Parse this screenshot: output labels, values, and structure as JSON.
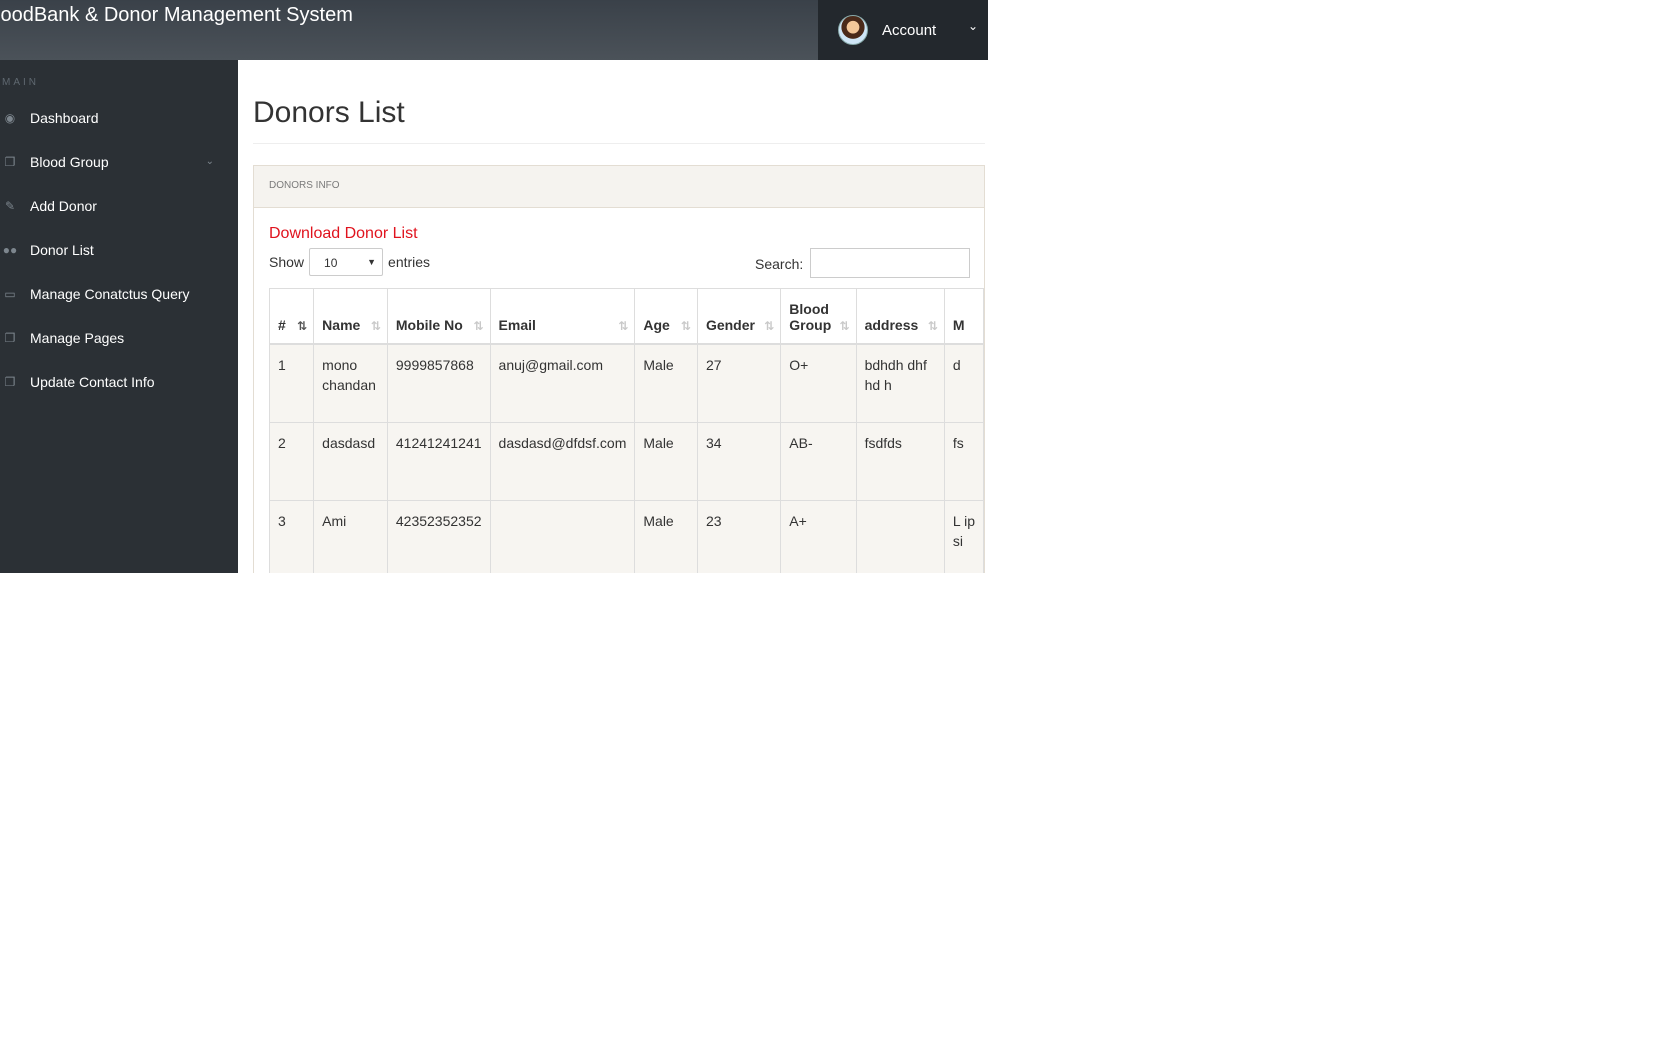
{
  "header": {
    "brand": "loodBank & Donor Management System",
    "account_label": "Account"
  },
  "sidebar": {
    "section": "MAIN",
    "items": [
      {
        "label": "Dashboard",
        "icon": "dashboard-icon"
      },
      {
        "label": "Blood Group",
        "icon": "copy-icon"
      },
      {
        "label": "Add Donor",
        "icon": "edit-icon"
      },
      {
        "label": "Donor List",
        "icon": "users-icon"
      },
      {
        "label": "Manage Conatctus Query",
        "icon": "desktop-icon"
      },
      {
        "label": "Manage Pages",
        "icon": "copy-icon"
      },
      {
        "label": "Update Contact Info",
        "icon": "copy-icon"
      }
    ]
  },
  "page": {
    "title": "Donors List",
    "panel_title": "DONORS INFO",
    "download_link": "Download Donor List",
    "show_label": "Show",
    "entries_value": "10",
    "entries_label": "entries",
    "search_label": "Search:"
  },
  "table": {
    "headers": [
      "#",
      "Name",
      "Mobile No",
      "Email",
      "Age",
      "Gender",
      "Blood Group",
      "address",
      "M"
    ],
    "rows": [
      [
        "1",
        "mono chandan",
        "9999857868",
        "anuj@gmail.com",
        "Male",
        "27",
        "O+",
        "bdhdh dhf hd h",
        "d"
      ],
      [
        "2",
        "dasdasd",
        "41241241241",
        "dasdasd@dfdsf.com",
        "Male",
        "34",
        "AB-",
        "fsdfds",
        "fs"
      ],
      [
        "3",
        "Ami",
        "42352352352",
        "",
        "Male",
        "23",
        "A+",
        "",
        "L ip si"
      ]
    ]
  }
}
